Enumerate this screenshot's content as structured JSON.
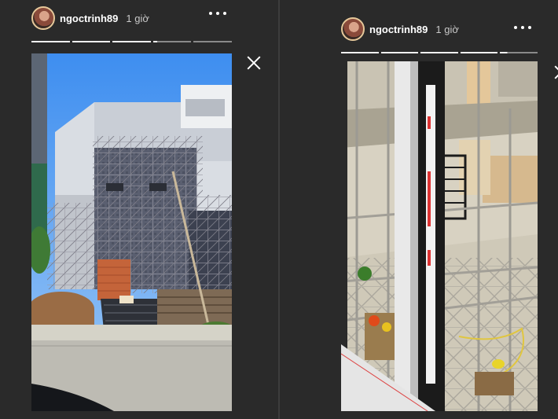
{
  "stories": [
    {
      "username": "ngoctrinh89",
      "time_ago": "1 giờ",
      "progress": [
        1,
        1,
        1,
        0.1,
        0
      ],
      "media": {
        "scene": "construction-site-exterior",
        "description_icon": "building-under-construction-photo"
      }
    },
    {
      "username": "ngoctrinh89",
      "time_ago": "1 giờ",
      "progress": [
        1,
        1,
        1,
        1,
        0.2
      ],
      "media": {
        "scene": "construction-site-interior",
        "description_icon": "scaffolding-through-window-photo"
      }
    }
  ],
  "icons": {
    "more": "more-options-icon",
    "close": "close-icon"
  },
  "colors": {
    "background": "#2a2a2a",
    "progress_active": "#f2f2f2",
    "progress_inactive": "#8a8a8a"
  }
}
